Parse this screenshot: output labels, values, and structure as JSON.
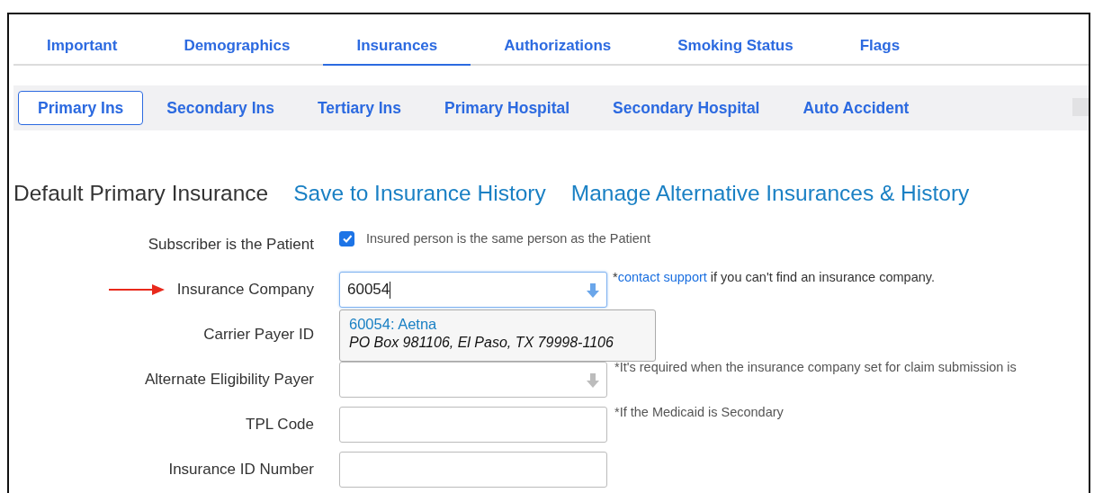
{
  "tabs": [
    {
      "label": "Important",
      "selected": false
    },
    {
      "label": "Demographics",
      "selected": false
    },
    {
      "label": "Insurances",
      "selected": true
    },
    {
      "label": "Authorizations",
      "selected": false
    },
    {
      "label": "Smoking Status",
      "selected": false
    },
    {
      "label": "Flags",
      "selected": false
    }
  ],
  "subtabs": [
    {
      "label": "Primary Ins",
      "selected": true
    },
    {
      "label": "Secondary Ins",
      "selected": false
    },
    {
      "label": "Tertiary Ins",
      "selected": false
    },
    {
      "label": "Primary Hospital",
      "selected": false
    },
    {
      "label": "Secondary Hospital",
      "selected": false
    },
    {
      "label": "Auto Accident",
      "selected": false
    }
  ],
  "heading": {
    "title": "Default Primary Insurance",
    "links": [
      "Save to Insurance History",
      "Manage Alternative Insurances & History"
    ]
  },
  "form": [
    {
      "kind": "checkbox",
      "label": "Subscriber is the Patient",
      "checked": true,
      "text": "Insured person is the same person as the Patient"
    },
    {
      "kind": "select",
      "label": "Insurance Company",
      "pointer": true,
      "value": "60054",
      "focused": true,
      "hint": {
        "prefix": "*",
        "link": "contact support",
        "text": " if you can't find an insurance company."
      },
      "suggestions": [
        {
          "name": "60054: Aetna",
          "address": "PO Box 981106, El Paso, TX 79998-1106"
        }
      ]
    },
    {
      "kind": "covered",
      "label": "Carrier Payer ID"
    },
    {
      "kind": "select",
      "label": "Alternate Eligibility Payer",
      "focused": false,
      "hint": {
        "text": "*It's required when the insurance company set for claim submission is"
      }
    },
    {
      "kind": "text",
      "label": "TPL Code",
      "hint": {
        "text": "*If the Medicaid is Secondary"
      }
    },
    {
      "kind": "text",
      "label": "Insurance ID Number"
    }
  ]
}
